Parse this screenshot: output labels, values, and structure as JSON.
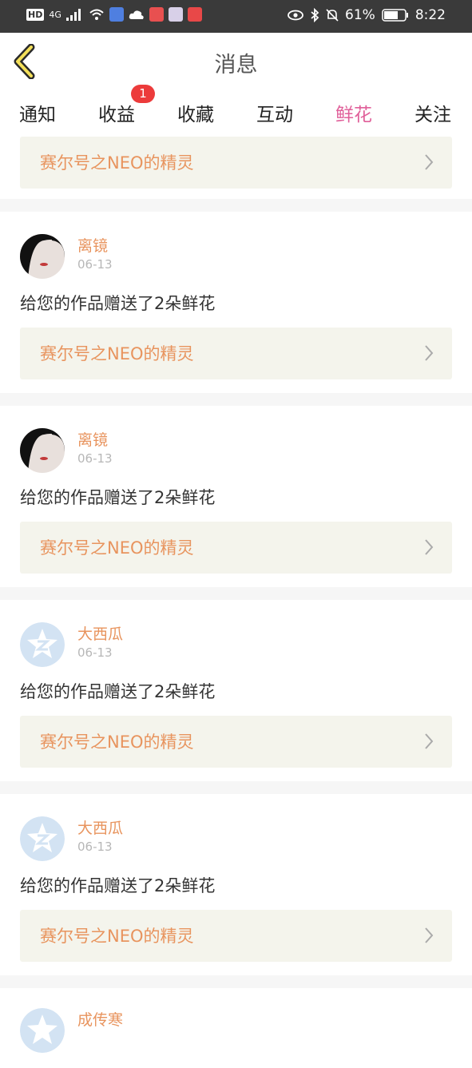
{
  "status_bar": {
    "network": "HD",
    "signal": "4G",
    "battery": "61%",
    "time": "8:22"
  },
  "header": {
    "title": "消息"
  },
  "tabs": [
    {
      "label": "通知"
    },
    {
      "label": "收益",
      "badge": "1"
    },
    {
      "label": "收藏"
    },
    {
      "label": "互动"
    },
    {
      "label": "鲜花",
      "active": true
    },
    {
      "label": "关注"
    }
  ],
  "first_link": "赛尔号之NEO的精灵",
  "items": [
    {
      "user": "离镜",
      "date": "06-13",
      "message": "给您的作品赠送了2朵鲜花",
      "link": "赛尔号之NEO的精灵",
      "avatar": "photo-avatar"
    },
    {
      "user": "离镜",
      "date": "06-13",
      "message": "给您的作品赠送了2朵鲜花",
      "link": "赛尔号之NEO的精灵",
      "avatar": "photo-avatar"
    },
    {
      "user": "大西瓜",
      "date": "06-13",
      "message": "给您的作品赠送了2朵鲜花",
      "link": "赛尔号之NEO的精灵",
      "avatar": "default-avatar"
    },
    {
      "user": "大西瓜",
      "date": "06-13",
      "message": "给您的作品赠送了2朵鲜花",
      "link": "赛尔号之NEO的精灵",
      "avatar": "default-avatar"
    },
    {
      "user": "成传寒",
      "avatar": "default-avatar"
    }
  ],
  "colors": {
    "accent": "#e0609a",
    "name": "#e8945e",
    "badge": "#ec3b3b"
  }
}
